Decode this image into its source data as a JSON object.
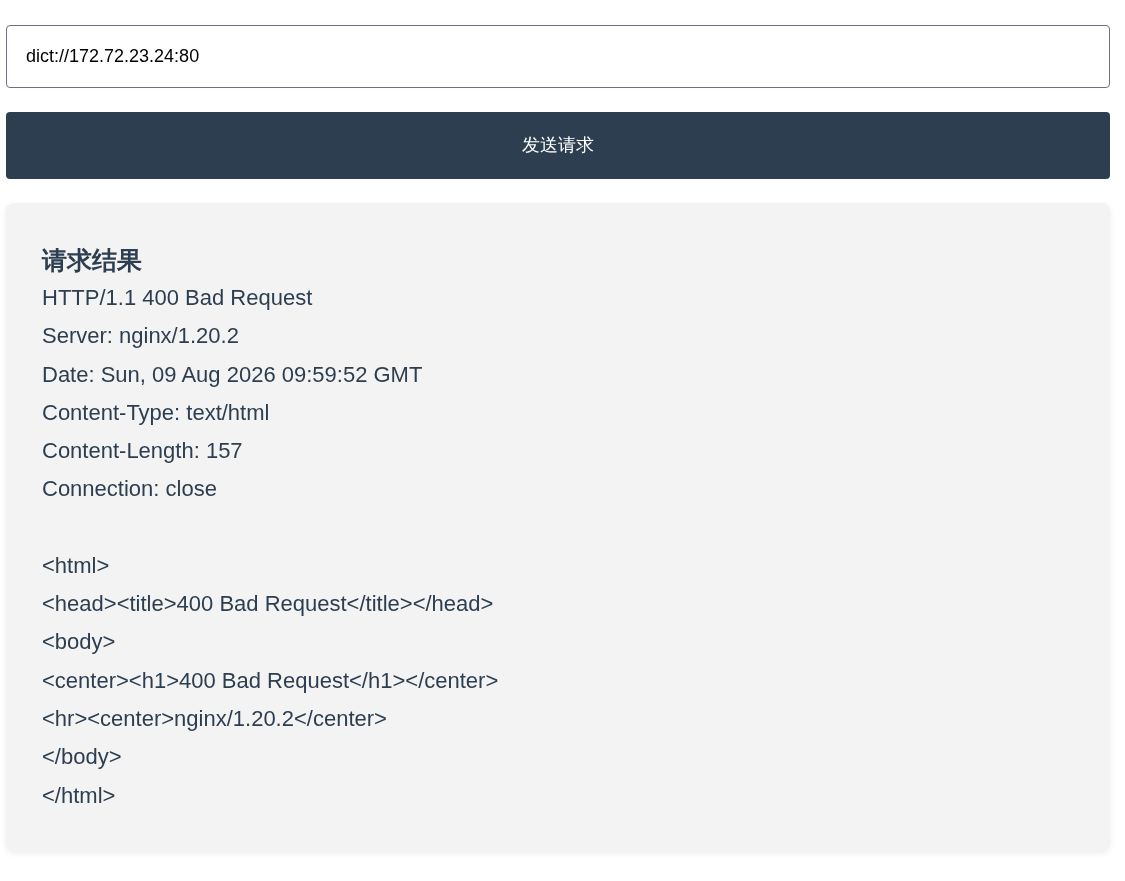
{
  "url_field": {
    "value": "dict://172.72.23.24:80"
  },
  "send_button": {
    "label": "发送请求"
  },
  "result": {
    "title": "请求结果",
    "headers": [
      "HTTP/1.1 400 Bad Request",
      "Server: nginx/1.20.2",
      "Date: Sun, 09 Aug 2026 09:59:52 GMT",
      "Content-Type: text/html",
      "Content-Length: 157",
      "Connection: close"
    ],
    "body": [
      "<html>",
      "<head><title>400 Bad Request</title></head>",
      "<body>",
      "<center><h1>400 Bad Request</h1></center>",
      "<hr><center>nginx/1.20.2</center>",
      "</body>",
      "</html>"
    ]
  }
}
